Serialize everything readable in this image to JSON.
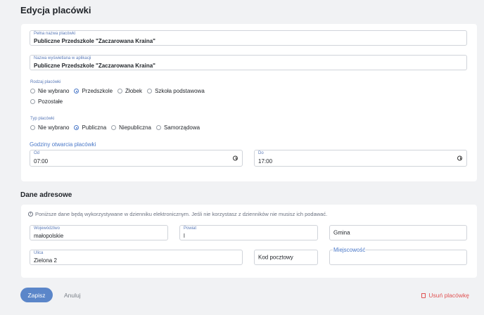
{
  "page": {
    "title": "Edycja placówki",
    "address_section_title": "Dane adresowe"
  },
  "facility": {
    "full_name_label": "Pełna nazwa placówki",
    "full_name_value": "Publiczne Przedszkole \"Zaczarowana Kraina\"",
    "display_name_label": "Nazwa wyświetlana w aplikacji",
    "display_name_value": "Publiczne Przedszkole \"Zaczarowana Kraina\"",
    "kind_label": "Rodzaj placówki",
    "kind_options": [
      "Nie wybrano",
      "Przedszkole",
      "Żłobek",
      "Szkoła podstawowa",
      "Pozostałe"
    ],
    "kind_selected": "Przedszkole",
    "type_label": "Typ placówki",
    "type_options": [
      "Nie wybrano",
      "Publiczna",
      "Niepubliczna",
      "Samorządowa"
    ],
    "type_selected": "Publiczna",
    "hours_title": "Godziny otwarcia placówki",
    "from_label": "Od",
    "from_value": "07:00",
    "to_label": "Do",
    "to_value": "17:00"
  },
  "address": {
    "info": "Poniższe dane będą wykorzystywane w dzienniku elektronicznym. Jeśli nie korzystasz z dzienników nie musisz ich podawać.",
    "voivodeship_label": "Województwo",
    "voivodeship_value": "małopolskie",
    "county_label": "Powiat",
    "county_value": "l",
    "commune_placeholder": "Gmina",
    "street_label": "Ulica",
    "street_value": "Zielona 2",
    "postal_placeholder": "Kod pocztowy",
    "city_label": "Miejscowość"
  },
  "actions": {
    "save": "Zapisz",
    "cancel": "Anuluj",
    "delete": "Usuń placówkę"
  },
  "colors": {
    "accent": "#5b86c9",
    "danger": "#e05252",
    "label": "#5a7ab8"
  }
}
